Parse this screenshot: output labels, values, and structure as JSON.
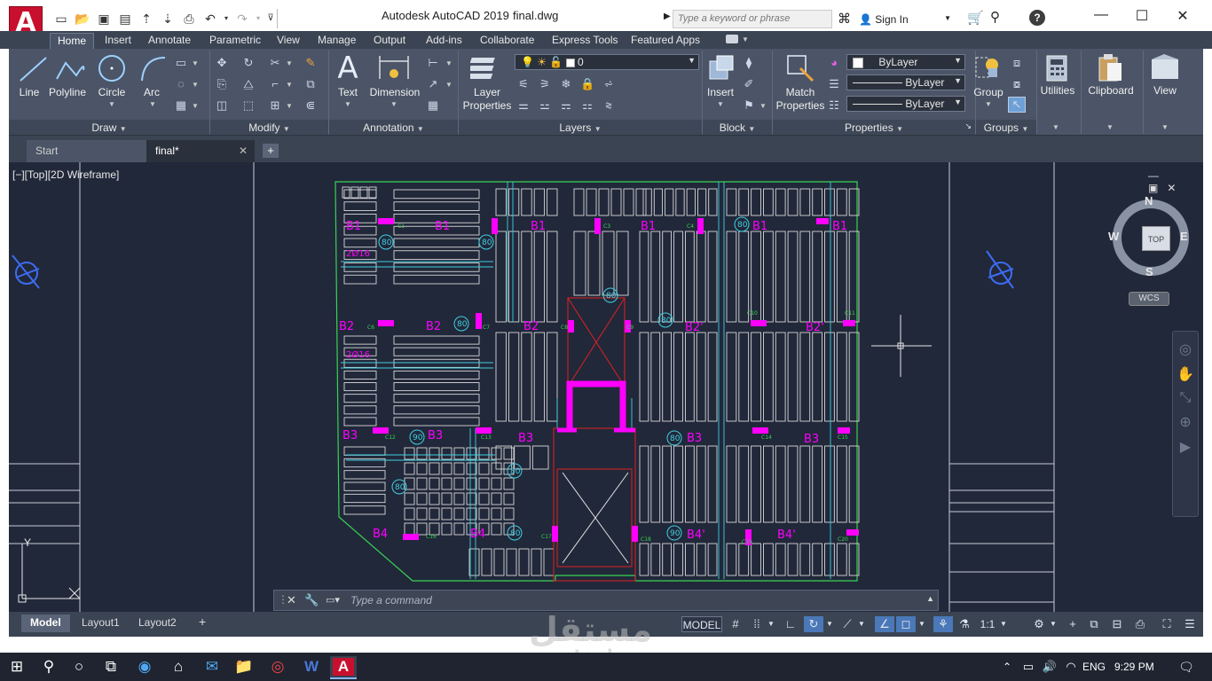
{
  "window": {
    "app_title": "Autodesk AutoCAD 2019",
    "file_title": "final.dwg",
    "search_placeholder": "Type a keyword or phrase",
    "sign_in": "Sign In"
  },
  "ribbon": {
    "tabs": [
      "Home",
      "Insert",
      "Annotate",
      "Parametric",
      "View",
      "Manage",
      "Output",
      "Add-ins",
      "Collaborate",
      "Express Tools",
      "Featured Apps"
    ],
    "active_tab": "Home",
    "panels": {
      "draw": {
        "label": "Draw",
        "tools": [
          "Line",
          "Polyline",
          "Circle",
          "Arc"
        ]
      },
      "modify": {
        "label": "Modify"
      },
      "annotation": {
        "label": "Annotation",
        "tools": [
          "Text",
          "Dimension"
        ]
      },
      "layers": {
        "label": "Layers",
        "tool_line1": "Layer",
        "tool_line2": "Properties",
        "current_layer": "0"
      },
      "block": {
        "label": "Block",
        "tool": "Insert"
      },
      "properties": {
        "label": "Properties",
        "match_line1": "Match",
        "match_line2": "Properties",
        "color": "ByLayer",
        "linetype": "ByLayer",
        "lineweight": "ByLayer"
      },
      "groups": {
        "label": "Groups",
        "tool": "Group"
      },
      "utilities": {
        "label": "Utilities"
      },
      "clipboard": {
        "label": "Clipboard"
      },
      "view": {
        "label": "View"
      }
    }
  },
  "file_tabs": {
    "start": "Start",
    "current": "final*"
  },
  "viewport": {
    "label": "[−][Top][2D Wireframe]",
    "viewcube": {
      "n": "N",
      "s": "S",
      "e": "E",
      "w": "W",
      "top": "TOP",
      "wcs": "WCS"
    },
    "ucs": {
      "y": "Y"
    }
  },
  "command": {
    "placeholder": "Type  a  command"
  },
  "layout_tabs": [
    "Model",
    "Layout1",
    "Layout2"
  ],
  "status": {
    "model": "MODEL",
    "scale": "1:1"
  },
  "watermark": {
    "main": "مستقل",
    "sub": "mostaql.com"
  },
  "taskbar": {
    "lang": "ENG",
    "time": "9:29 PM"
  },
  "drawing": {
    "beam_labels": [
      "B1",
      "B1",
      "B1",
      "B1",
      "B1",
      "B1",
      "B2",
      "B2",
      "B2",
      "B2'",
      "B2'",
      "B3",
      "B3",
      "B3",
      "B3",
      "B3",
      "B4",
      "B4",
      "B4'",
      "B4'"
    ],
    "rebar_labels": [
      "2Ø16",
      "2Ø16"
    ],
    "circle_tags": [
      "80",
      "80",
      "80",
      "80",
      "80",
      "90",
      "80",
      "80",
      "80",
      "80",
      "90",
      "80"
    ],
    "column_tags": [
      "C1",
      "C3",
      "C4",
      "C6",
      "C7",
      "C8",
      "C9",
      "C10",
      "C11",
      "C12",
      "C13",
      "C14",
      "C15",
      "C16",
      "C17",
      "C18",
      "C19",
      "C20"
    ]
  },
  "colors": {
    "accent": "#c8102e",
    "viewport_bg": "#21283a",
    "ribbon_bg": "#4b5567",
    "drawing_green": "#39d353",
    "drawing_magenta": "#ff00ff",
    "drawing_cyan": "#3fd0e0"
  }
}
